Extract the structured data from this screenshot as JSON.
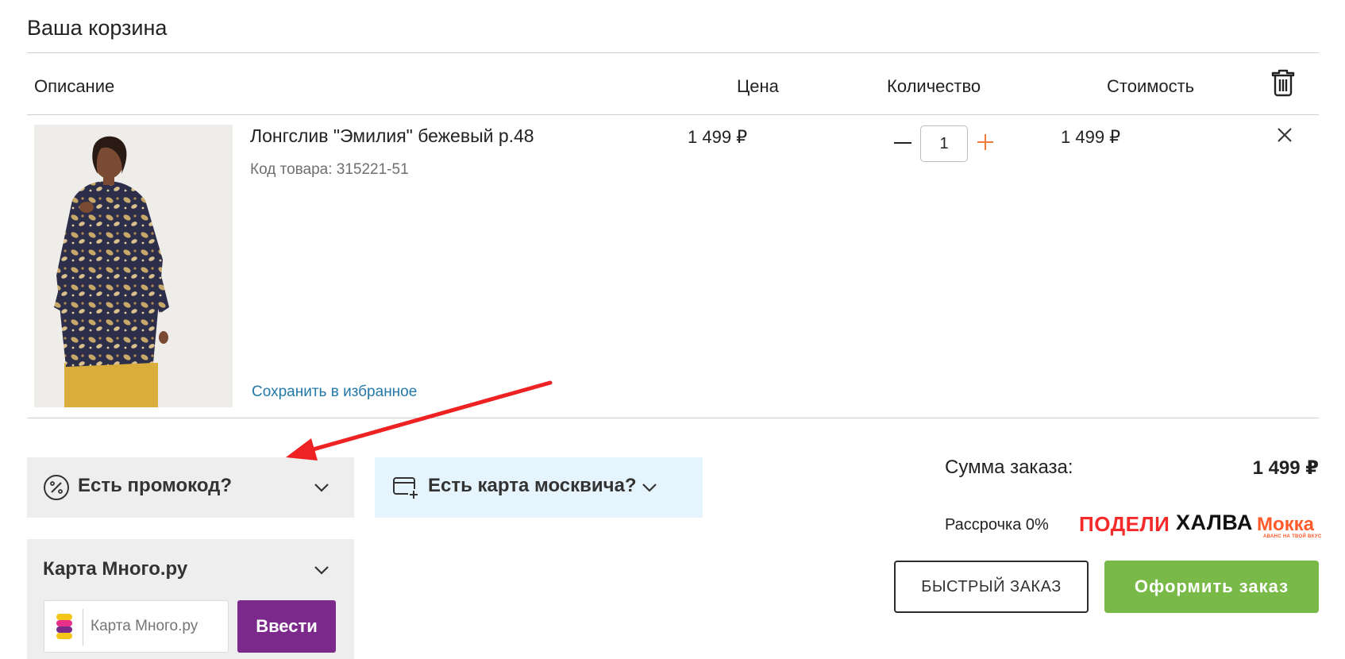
{
  "cart": {
    "title": "Ваша корзина",
    "headers": {
      "description": "Описание",
      "price": "Цена",
      "quantity": "Количество",
      "total": "Стоимость"
    }
  },
  "item": {
    "name": "Лонгслив \"Эмилия\" бежевый р.48",
    "code": "Код товара: 315221-51",
    "price": "1 499 ₽",
    "quantity": "1",
    "total": "1 499 ₽",
    "save_to_favorites": "Сохранить в избранное"
  },
  "promo": {
    "label": "Есть промокод?"
  },
  "moscow_card": {
    "label": "Есть карта москвича?"
  },
  "mnogo": {
    "title": "Карта Много.ру",
    "placeholder": "Карта Много.ру",
    "submit_label": "Ввести"
  },
  "summary": {
    "sum_label": "Сумма заказа:",
    "sum_value": "1 499 ₽",
    "installment_label": "Рассрочка 0%",
    "logos": {
      "podeli": "ПОДЕЛИ",
      "halva": "ХАЛВА",
      "mokka": "Мокка",
      "mokka_tagline": "АВАНС НА ТВОЙ ВКУС"
    }
  },
  "actions": {
    "quick_order": "БЫСТРЫЙ ЗАКАЗ",
    "checkout": "Оформить заказ"
  },
  "colors": {
    "link": "#2378a8",
    "plus": "#f07a3a",
    "checkout": "#79b948",
    "mnogo_button": "#7b2a8c",
    "annotation_arrow": "#ee2222"
  },
  "icons": [
    "trash-icon",
    "close-icon",
    "plus-icon",
    "minus-icon",
    "percent-icon",
    "chevron-down-icon",
    "card-plus-icon",
    "mnogo-logo-icon"
  ]
}
